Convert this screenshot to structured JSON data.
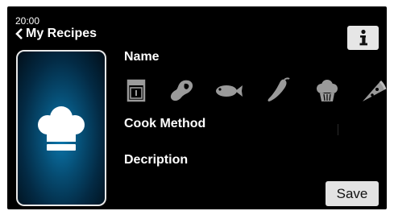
{
  "status": {
    "time": "20:00"
  },
  "header": {
    "back_label": "My Recipes",
    "back_icon": "chevron-left-icon",
    "info_icon": "info-icon"
  },
  "recipe_card": {
    "icon": "chef-hat-icon",
    "glow_color": "#0b79b0"
  },
  "form": {
    "name_label": "Name",
    "cook_method_label": "Cook Method",
    "description_label": "Decription"
  },
  "categories": [
    {
      "icon": "oven-icon",
      "color": "#9a9a9a"
    },
    {
      "icon": "meat-icon",
      "color": "#9a9a9a"
    },
    {
      "icon": "fish-icon",
      "color": "#9a9a9a"
    },
    {
      "icon": "vegetable-icon",
      "color": "#9a9a9a"
    },
    {
      "icon": "muffin-icon",
      "color": "#9a9a9a"
    },
    {
      "icon": "pizza-icon",
      "color": "#9a9a9a"
    }
  ],
  "actions": {
    "save_label": "Save"
  },
  "colors": {
    "background": "#000000",
    "button_bg": "#e3e3e3",
    "icon_gray": "#9a9a9a"
  }
}
